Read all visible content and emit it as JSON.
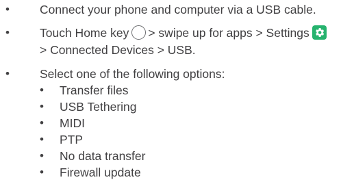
{
  "bullets": {
    "b1": "Connect your phone and computer via a USB cable.",
    "b2_part1": "Touch Home key",
    "b2_part2": "> swipe up for apps > Settings",
    "b2_part3": "> Connected Devices > USB.",
    "b3": "Select one of the following options:"
  },
  "options": [
    "Transfer files",
    "USB Tethering",
    "MIDI",
    "PTP",
    "No data transfer",
    "Firewall update"
  ],
  "bullet_glyph": "•",
  "icons": {
    "home": "home-key-icon",
    "settings": "settings-icon"
  },
  "colors": {
    "text": "#414042",
    "settings_icon_bg": "#26b36e"
  }
}
